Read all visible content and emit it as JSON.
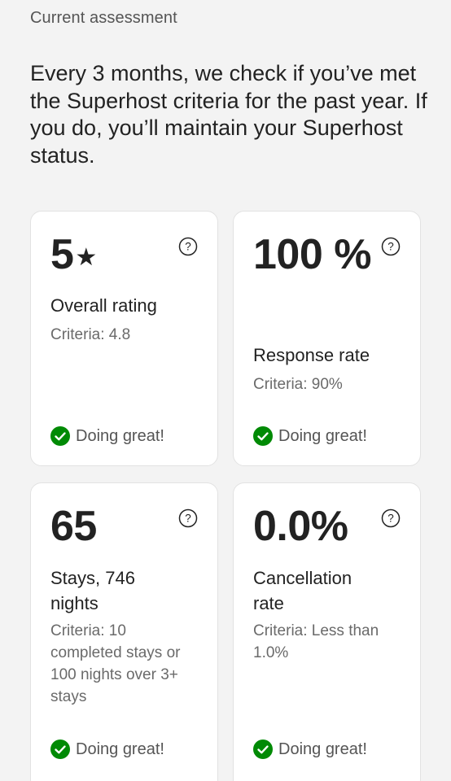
{
  "header": {
    "section_label": "Current assessment",
    "intro_text": "Every 3 months, we check if you’ve met the Superhost criteria for the past year. If you do, you’ll maintain your Superhost status."
  },
  "cards": [
    {
      "metric": "5",
      "metric_icon": "star-icon",
      "title": "Overall rating",
      "criteria": "Criteria: 4.8",
      "status": "Doing great!"
    },
    {
      "metric": "100 %",
      "title": "Response rate",
      "criteria": "Criteria: 90%",
      "status": "Doing great!"
    },
    {
      "metric": "65",
      "title": "Stays, 746 nights",
      "criteria": "Criteria: 10 completed stays or 100 nights over 3+ stays",
      "status": "Doing great!"
    },
    {
      "metric": "0.0%",
      "title": "Cancellation rate",
      "criteria": "Criteria: Less than 1.0%",
      "status": "Doing great!"
    }
  ],
  "colors": {
    "success": "#008a05",
    "text_primary": "#222222",
    "text_secondary": "#6a6a6a",
    "background": "#f3f3f3"
  }
}
